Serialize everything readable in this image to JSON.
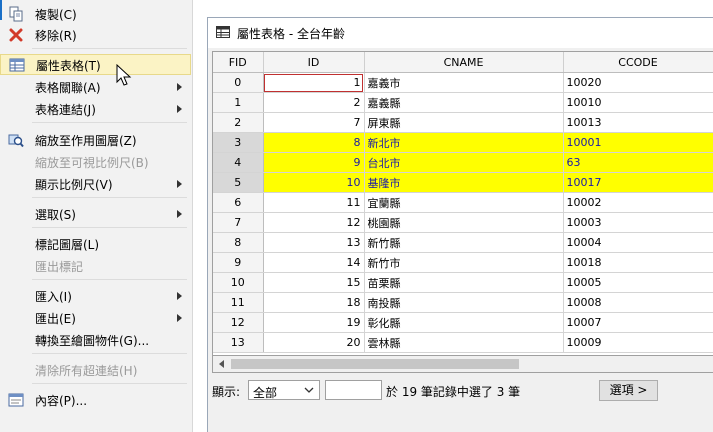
{
  "menu": {
    "items": [
      {
        "label": "複製(C)",
        "icon": "copy-icon"
      },
      {
        "label": "移除(R)",
        "icon": "remove-x-icon"
      },
      {
        "label": "屬性表格(T)",
        "icon": "table-icon"
      },
      {
        "label": "表格關聯(A)"
      },
      {
        "label": "表格連結(J)"
      },
      {
        "label": "縮放至作用圖層(Z)",
        "icon": "zoom-layer-icon"
      },
      {
        "label": "縮放至可視比例尺(B)"
      },
      {
        "label": "顯示比例尺(V)"
      },
      {
        "label": "選取(S)"
      },
      {
        "label": "標記圖層(L)"
      },
      {
        "label": "匯出標記"
      },
      {
        "label": "匯入(I)"
      },
      {
        "label": "匯出(E)"
      },
      {
        "label": "轉換至繪圖物件(G)..."
      },
      {
        "label": "清除所有超連結(H)"
      },
      {
        "label": "內容(P)...",
        "icon": "properties-icon"
      }
    ]
  },
  "window": {
    "title": "屬性表格 - 全台年齡",
    "columns": [
      "FID",
      "ID",
      "CNAME",
      "CCODE"
    ],
    "rows": [
      {
        "fid": "0",
        "id": "1",
        "cname": "嘉義市",
        "ccode": "10020",
        "selected": false
      },
      {
        "fid": "1",
        "id": "2",
        "cname": "嘉義縣",
        "ccode": "10010",
        "selected": false
      },
      {
        "fid": "2",
        "id": "7",
        "cname": "屏東縣",
        "ccode": "10013",
        "selected": false
      },
      {
        "fid": "3",
        "id": "8",
        "cname": "新北市",
        "ccode": "10001",
        "selected": true
      },
      {
        "fid": "4",
        "id": "9",
        "cname": "台北市",
        "ccode": "63",
        "selected": true
      },
      {
        "fid": "5",
        "id": "10",
        "cname": "基隆市",
        "ccode": "10017",
        "selected": true
      },
      {
        "fid": "6",
        "id": "11",
        "cname": "宜蘭縣",
        "ccode": "10002",
        "selected": false
      },
      {
        "fid": "7",
        "id": "12",
        "cname": "桃園縣",
        "ccode": "10003",
        "selected": false
      },
      {
        "fid": "8",
        "id": "13",
        "cname": "新竹縣",
        "ccode": "10004",
        "selected": false
      },
      {
        "fid": "9",
        "id": "14",
        "cname": "新竹市",
        "ccode": "10018",
        "selected": false
      },
      {
        "fid": "10",
        "id": "15",
        "cname": "苗栗縣",
        "ccode": "10005",
        "selected": false
      },
      {
        "fid": "11",
        "id": "18",
        "cname": "南投縣",
        "ccode": "10008",
        "selected": false
      },
      {
        "fid": "12",
        "id": "19",
        "cname": "彰化縣",
        "ccode": "10007",
        "selected": false
      },
      {
        "fid": "13",
        "id": "20",
        "cname": "雲林縣",
        "ccode": "10009",
        "selected": false
      }
    ],
    "status": {
      "show_label": "顯示:",
      "filter_value": "全部",
      "record_text": "於 19 筆記錄中選了 3 筆",
      "options_label": "選項 >"
    }
  },
  "colors": {
    "selection": "#ffff00",
    "selection_text": "#1a1aa6",
    "menu_highlight": "#fbf3c5"
  }
}
